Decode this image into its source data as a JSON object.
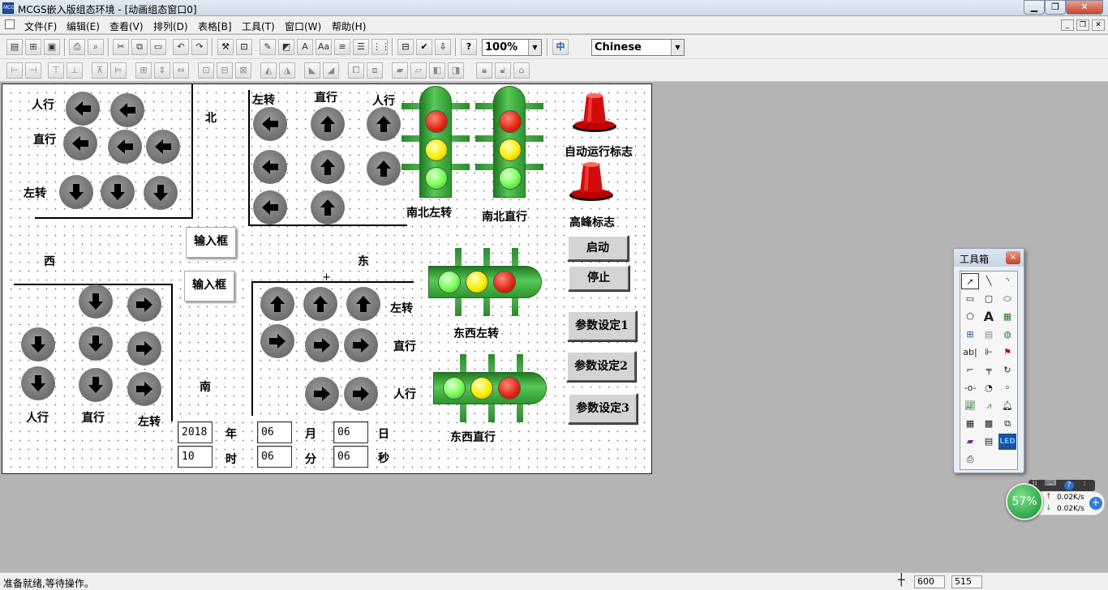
{
  "window": {
    "title": "MCGS嵌入版组态环境 - [动画组态窗口0]",
    "app_icon_text": "MCGS"
  },
  "menu": [
    "文件(F)",
    "编辑(E)",
    "查看(V)",
    "排列(D)",
    "表格[B]",
    "工具(T)",
    "窗口(W)",
    "帮助(H)"
  ],
  "toolbar": {
    "zoom": "100%",
    "language": "Chinese"
  },
  "canvas": {
    "north": "北",
    "west": "西",
    "east": "东",
    "south": "南",
    "nw_labels": [
      "人行",
      "直行",
      "左转"
    ],
    "ne_labels": [
      "左转",
      "直行",
      "人行"
    ],
    "se_labels": [
      "左转",
      "直行",
      "人行"
    ],
    "sw_labels": [
      "人行",
      "直行",
      "左转"
    ],
    "input_box_1": "输入框",
    "input_box_2": "输入框",
    "light_ns_left": "南北左转",
    "light_ns_straight": "南北直行",
    "light_ew_left": "东西左转",
    "light_ew_straight": "东西直行",
    "auto_run_flag": "自动运行标志",
    "peak_flag": "高峰标志",
    "buttons": {
      "start": "启动",
      "stop": "停止",
      "param1": "参数设定1",
      "param2": "参数设定2",
      "param3": "参数设定3"
    },
    "date": {
      "year": "2018",
      "year_unit": "年",
      "month": "06",
      "month_unit": "月",
      "day": "06",
      "day_unit": "日"
    },
    "time": {
      "hour": "10",
      "hour_unit": "时",
      "minute": "06",
      "minute_unit": "分",
      "second": "06",
      "second_unit": "秒"
    }
  },
  "toolbox": {
    "title": "工具箱",
    "close": "×"
  },
  "net_widget": {
    "percent": "57%",
    "up": "0.02K/s",
    "down": "0.02K/s"
  },
  "status": {
    "message": "准备就绪,等待操作。",
    "x": "600",
    "y": "515"
  },
  "colors": {
    "signal_red": "#e02a14",
    "signal_yellow": "#f6f000",
    "signal_green": "#7cff5a",
    "light_body": "#3aa83a",
    "arrow_disc": "#7a7a7a"
  }
}
